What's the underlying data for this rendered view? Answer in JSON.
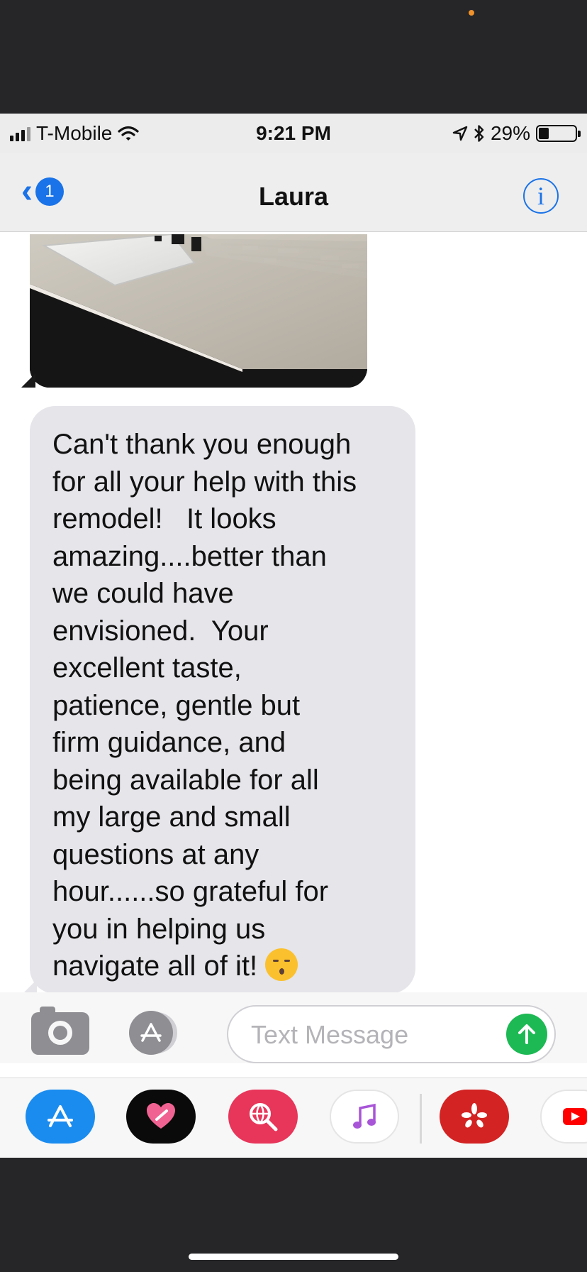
{
  "status_bar": {
    "carrier": "T-Mobile",
    "time": "9:21 PM",
    "battery": "29%",
    "battery_level": 0.29,
    "icons": [
      "signal-bars-icon",
      "wifi-icon",
      "location-arrow-icon",
      "bluetooth-icon",
      "battery-icon"
    ]
  },
  "nav": {
    "back_badge": "1",
    "contact_name": "Laura",
    "info_glyph": "i"
  },
  "conversation": {
    "image_message": "photo of bathroom vanity with white undermount sink, dark faucet and glass tile backsplash",
    "text_message": "Can't thank you enough\nfor all your help with this\nremodel!   It looks\namazing....better than\nwe could have\nenvisioned.  Your\nexcellent taste,\npatience, gentle but\nfirm guidance, and\nbeing available for all\nmy large and small\nquestions at any\nhour......so grateful for\nyou in helping us\nnavigate all of it! ",
    "emoji": "kissing-face-with-closed-eyes"
  },
  "input": {
    "placeholder": "Text Message",
    "value": ""
  },
  "app_tray": {
    "apps": [
      "app-store-icon",
      "digital-touch-icon",
      "web-search-icon",
      "music-icon",
      "yelp-icon",
      "youtube-icon"
    ]
  },
  "colors": {
    "ios_blue": "#1a73e8",
    "bubble_gray": "#e5e5ea",
    "send_green": "#1db954",
    "chrome_dark": "#262628"
  }
}
